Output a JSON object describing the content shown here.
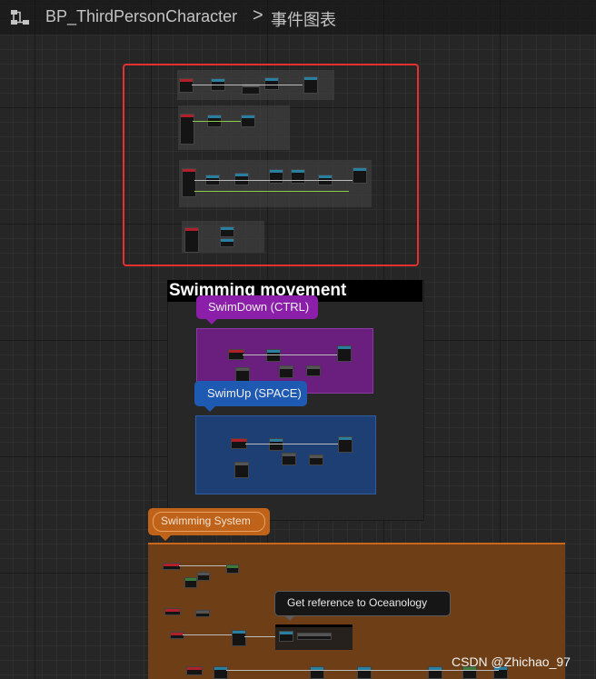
{
  "breadcrumb": {
    "blueprint": "BP_ThirdPersonCharacter",
    "separator": ">",
    "graph": "事件图表",
    "icon": "blueprint-graph-icon"
  },
  "comments": {
    "swimming_movement": "Swimming movement",
    "swim_down": "SwimDown  (CTRL)",
    "swim_up": "SwimUp (SPACE)",
    "swimming_system": "Swimming System",
    "get_reference": "Get reference to Oceanology"
  },
  "colors": {
    "selection": "#e53030",
    "swim_down": "#8b1fa9",
    "swim_up": "#1f5ab2",
    "swimming_system": "#c0631a"
  },
  "watermark": "CSDN @Zhichao_97"
}
